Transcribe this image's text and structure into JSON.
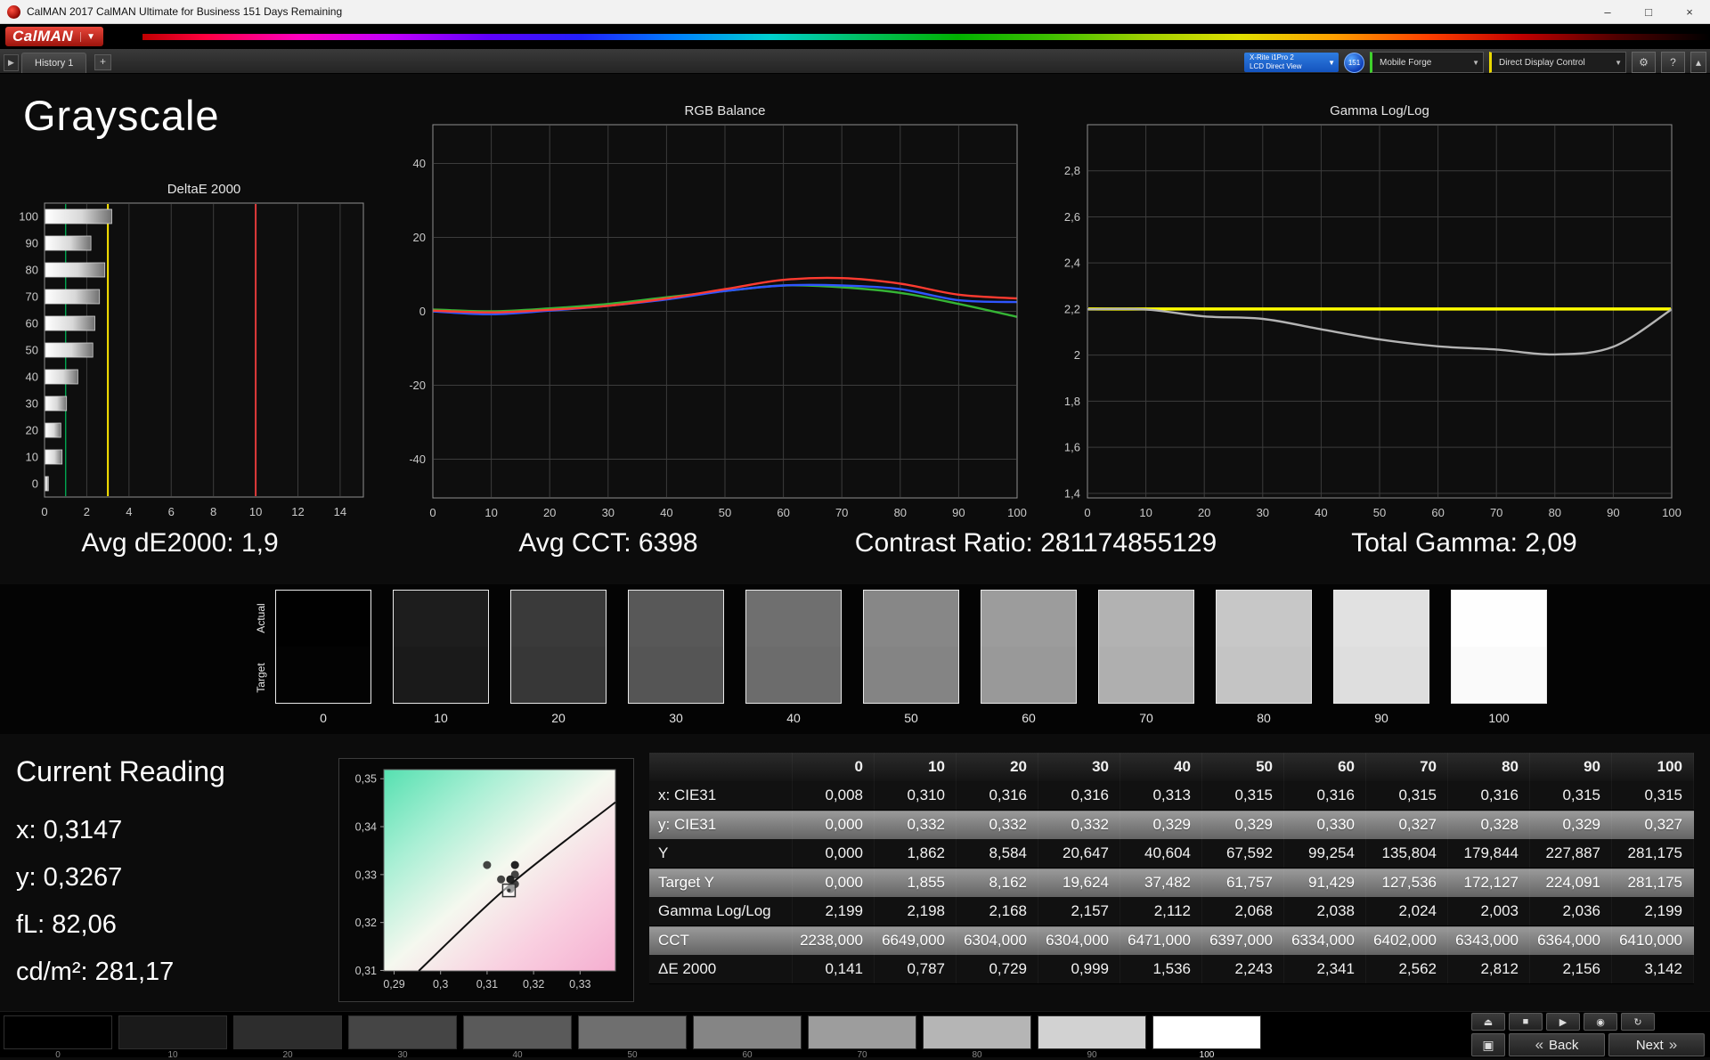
{
  "window": {
    "title": "CalMAN 2017 CalMAN Ultimate for Business 151 Days Remaining",
    "minimize": "–",
    "maximize": "□",
    "close": "×"
  },
  "brand": {
    "logo_text": "CalMAN",
    "caret": "▼"
  },
  "tab_bar": {
    "scroll_glyph": "▶",
    "history_tab": "History 1",
    "add_tab": "+"
  },
  "device_bar": {
    "meter_line1": "X-Rite i1Pro 2",
    "meter_line2": "LCD Direct View",
    "caret": "▼",
    "badge": "151",
    "source": "Mobile Forge",
    "display_control": "Direct Display Control",
    "settings_glyph": "⚙",
    "help_glyph": "?",
    "collapse_glyph": "▴"
  },
  "page_title": "Grayscale",
  "stats": [
    "Avg dE2000: 1,9",
    "Avg CCT: 6398",
    "Contrast Ratio: 281174855129",
    "Total Gamma: 2,09"
  ],
  "chart_data": [
    {
      "id": "deltae",
      "type": "bar",
      "title": "DeltaE 2000",
      "orientation": "horizontal",
      "categories": [
        "100",
        "90",
        "80",
        "70",
        "60",
        "50",
        "40",
        "30",
        "20",
        "10",
        "0"
      ],
      "values": [
        3.142,
        2.156,
        2.812,
        2.562,
        2.341,
        2.243,
        1.536,
        0.999,
        0.729,
        0.787,
        0.141
      ],
      "xlim": [
        0,
        15.1
      ],
      "xticks": [
        0,
        2,
        4,
        6,
        8,
        10,
        12,
        14
      ],
      "reference_lines": [
        {
          "value": 1,
          "color": "#00a550"
        },
        {
          "value": 3,
          "color": "#ffe800"
        },
        {
          "value": 10,
          "color": "#e03a3a"
        }
      ],
      "bar_gradient": [
        "#ffffff",
        "#707070"
      ]
    },
    {
      "id": "rgb-balance",
      "type": "line",
      "title": "RGB Balance",
      "x": [
        0,
        10,
        20,
        30,
        40,
        50,
        60,
        70,
        80,
        90,
        100
      ],
      "xticks": [
        0,
        10,
        20,
        30,
        40,
        50,
        60,
        70,
        80,
        90,
        100
      ],
      "ylim": [
        -50.5,
        50.5
      ],
      "yticks": [
        {
          "v": 40,
          "label": "40"
        },
        {
          "v": 20,
          "label": "20"
        },
        {
          "v": 0,
          "label": "0"
        },
        {
          "v": -20,
          "label": "-20"
        },
        {
          "v": -40,
          "label": "-40"
        }
      ],
      "series": [
        {
          "name": "green",
          "color": "#35b535",
          "values": [
            0.5,
            0.0,
            0.8,
            2.0,
            3.8,
            5.5,
            7.0,
            6.5,
            5.0,
            2.0,
            -1.5
          ]
        },
        {
          "name": "blue",
          "color": "#2f55ff",
          "values": [
            0.0,
            -0.8,
            0.2,
            1.5,
            3.2,
            5.5,
            7.0,
            7.0,
            6.0,
            3.0,
            2.5
          ]
        },
        {
          "name": "red",
          "color": "#ff3b30",
          "values": [
            0.2,
            -0.3,
            0.4,
            1.5,
            3.5,
            6.0,
            8.5,
            9.0,
            7.5,
            4.5,
            3.5
          ]
        }
      ]
    },
    {
      "id": "gamma",
      "type": "line",
      "title": "Gamma Log/Log",
      "x": [
        0,
        10,
        20,
        30,
        40,
        50,
        60,
        70,
        80,
        90,
        100
      ],
      "xticks": [
        0,
        10,
        20,
        30,
        40,
        50,
        60,
        70,
        80,
        90,
        100
      ],
      "ylim": [
        1.38,
        3.0
      ],
      "yticks": [
        {
          "v": 2.8,
          "label": "2,8"
        },
        {
          "v": 2.6,
          "label": "2,6"
        },
        {
          "v": 2.4,
          "label": "2,4"
        },
        {
          "v": 2.2,
          "label": "2,2"
        },
        {
          "v": 2.0,
          "label": "2"
        },
        {
          "v": 1.8,
          "label": "1,8"
        },
        {
          "v": 1.6,
          "label": "1,6"
        },
        {
          "v": 1.4,
          "label": "1,4"
        }
      ],
      "target_line": {
        "value": 2.2,
        "color": "#ffff00"
      },
      "series": [
        {
          "name": "measured",
          "color": "#b4b4b4",
          "values": [
            2.199,
            2.198,
            2.168,
            2.157,
            2.112,
            2.068,
            2.038,
            2.024,
            2.003,
            2.036,
            2.199
          ]
        }
      ]
    },
    {
      "id": "cie",
      "type": "scatter",
      "title": "CIE 1931 xy",
      "xlim": [
        0.2878,
        0.3376
      ],
      "ylim": [
        0.3099,
        0.3519
      ],
      "xticks": [
        {
          "v": 0.29,
          "label": "0,29"
        },
        {
          "v": 0.3,
          "label": "0,3"
        },
        {
          "v": 0.31,
          "label": "0,31"
        },
        {
          "v": 0.32,
          "label": "0,32"
        },
        {
          "v": 0.33,
          "label": "0,33"
        }
      ],
      "yticks": [
        {
          "v": 0.31,
          "label": "0,31"
        },
        {
          "v": 0.32,
          "label": "0,32"
        },
        {
          "v": 0.33,
          "label": "0,33"
        },
        {
          "v": 0.34,
          "label": "0,34"
        },
        {
          "v": 0.35,
          "label": "0,35"
        }
      ],
      "locus": [
        [
          0.2953,
          0.3099
        ],
        [
          0.3145,
          0.3275
        ],
        [
          0.3376,
          0.3451
        ]
      ],
      "points": [
        [
          0.31,
          0.332
        ],
        [
          0.316,
          0.332
        ],
        [
          0.316,
          0.332
        ],
        [
          0.313,
          0.329
        ],
        [
          0.315,
          0.329
        ],
        [
          0.316,
          0.33
        ],
        [
          0.315,
          0.327
        ],
        [
          0.316,
          0.328
        ],
        [
          0.315,
          0.329
        ],
        [
          0.315,
          0.327
        ]
      ],
      "marker": [
        0.3147,
        0.3267
      ]
    }
  ],
  "swatch_strip": {
    "row_labels": [
      "Actual",
      "Target"
    ],
    "items": [
      {
        "label": "0",
        "actual": "#010101",
        "target": "#030303"
      },
      {
        "label": "10",
        "actual": "#1d1d1d",
        "target": "#1a1a1a"
      },
      {
        "label": "20",
        "actual": "#3a3a3a",
        "target": "#373737"
      },
      {
        "label": "30",
        "actual": "#585858",
        "target": "#555555"
      },
      {
        "label": "40",
        "actual": "#6f6f6f",
        "target": "#6c6c6c"
      },
      {
        "label": "50",
        "actual": "#878787",
        "target": "#848484"
      },
      {
        "label": "60",
        "actual": "#9c9c9c",
        "target": "#999999"
      },
      {
        "label": "70",
        "actual": "#b2b2b2",
        "target": "#afafaf"
      },
      {
        "label": "80",
        "actual": "#c7c7c7",
        "target": "#c4c4c4"
      },
      {
        "label": "90",
        "actual": "#e1e1e1",
        "target": "#dedede"
      },
      {
        "label": "100",
        "actual": "#fefefe",
        "target": "#fafafa"
      }
    ]
  },
  "reading": {
    "title": "Current Reading",
    "values": [
      "x: 0,3147",
      "y: 0,3267",
      "fL: 82,06",
      "cd/m²: 281,17"
    ]
  },
  "table": {
    "columns": [
      "0",
      "10",
      "20",
      "30",
      "40",
      "50",
      "60",
      "70",
      "80",
      "90",
      "100"
    ],
    "rows": [
      {
        "label": "x: CIE31",
        "values": [
          "0,008",
          "0,310",
          "0,316",
          "0,316",
          "0,313",
          "0,315",
          "0,316",
          "0,315",
          "0,316",
          "0,315",
          "0,315"
        ]
      },
      {
        "label": "y: CIE31",
        "values": [
          "0,000",
          "0,332",
          "0,332",
          "0,332",
          "0,329",
          "0,329",
          "0,330",
          "0,327",
          "0,328",
          "0,329",
          "0,327"
        ]
      },
      {
        "label": "Y",
        "values": [
          "0,000",
          "1,862",
          "8,584",
          "20,647",
          "40,604",
          "67,592",
          "99,254",
          "135,804",
          "179,844",
          "227,887",
          "281,175"
        ]
      },
      {
        "label": "Target Y",
        "values": [
          "0,000",
          "1,855",
          "8,162",
          "19,624",
          "37,482",
          "61,757",
          "91,429",
          "127,536",
          "172,127",
          "224,091",
          "281,175"
        ]
      },
      {
        "label": "Gamma Log/Log",
        "values": [
          "2,199",
          "2,198",
          "2,168",
          "2,157",
          "2,112",
          "2,068",
          "2,038",
          "2,024",
          "2,003",
          "2,036",
          "2,199"
        ]
      },
      {
        "label": "CCT",
        "values": [
          "2238,000",
          "6649,000",
          "6304,000",
          "6304,000",
          "6471,000",
          "6397,000",
          "6334,000",
          "6402,000",
          "6343,000",
          "6364,000",
          "6410,000"
        ]
      },
      {
        "label": "ΔE 2000",
        "values": [
          "0,141",
          "0,787",
          "0,729",
          "0,999",
          "1,536",
          "2,243",
          "2,341",
          "2,562",
          "2,812",
          "2,156",
          "3,142"
        ]
      }
    ]
  },
  "pattern_bar": {
    "items": [
      {
        "label": "0",
        "color": "#000000"
      },
      {
        "label": "10",
        "color": "#1a1a1a"
      },
      {
        "label": "20",
        "color": "#2d2d2d"
      },
      {
        "label": "30",
        "color": "#454545"
      },
      {
        "label": "40",
        "color": "#5a5a5a"
      },
      {
        "label": "50",
        "color": "#6f6f6f"
      },
      {
        "label": "60",
        "color": "#858585"
      },
      {
        "label": "70",
        "color": "#9d9d9d"
      },
      {
        "label": "80",
        "color": "#b5b5b5"
      },
      {
        "label": "90",
        "color": "#d2d2d2"
      },
      {
        "label": "100",
        "color": "#ffffff"
      }
    ]
  },
  "transport": {
    "eject_glyph": "⏏",
    "pattern_window_glyph": "▣",
    "buttons": [
      {
        "name": "stop",
        "glyph": "■"
      },
      {
        "name": "play",
        "glyph": "▶"
      },
      {
        "name": "snapshot",
        "glyph": "◉"
      },
      {
        "name": "refresh",
        "glyph": "↻"
      }
    ],
    "back_chevron": "«",
    "back_label": "Back",
    "next_label": "Next",
    "next_chevron": "»"
  }
}
